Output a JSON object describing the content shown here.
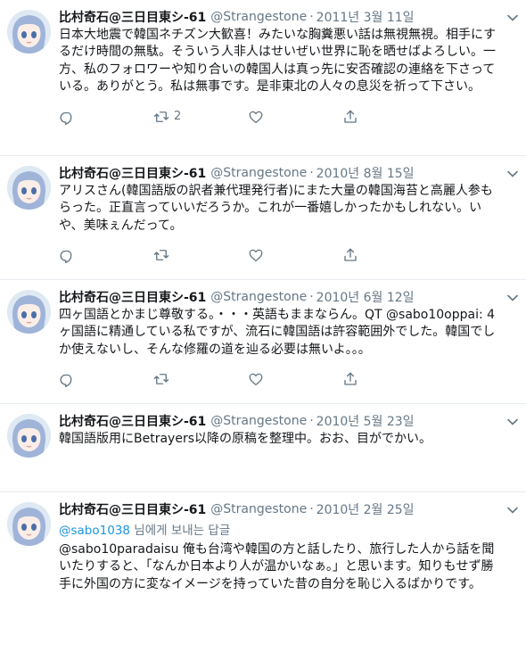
{
  "tweets": [
    {
      "name": "比村奇石@三日目東シ-61",
      "handle": "@Strangestone",
      "time": "2011년 3월 11일",
      "text": "日本大地震で韓国ネチズン大歓喜！みたいな胸糞悪い話は無視無視。相手にするだけ時間の無駄。そういう人非人はせいぜい世界に恥を晒せばよろしい。一方、私のフォロワーや知り合いの韓国人は真っ先に安否確認の連絡を下さっている。ありがとう。私は無事です。是非東北の人々の息災を祈って下さい。",
      "retweets": "2"
    },
    {
      "name": "比村奇石@三日目東シ-61",
      "handle": "@Strangestone",
      "time": "2010년 8월 15일",
      "text": "アリスさん(韓国語版の訳者兼代理発行者)にまた大量の韓国海苔と高麗人参もらった。正直言っていいだろうか。これが一番嬉しかったかもしれない。いや、美味ぇんだって。",
      "retweets": ""
    },
    {
      "name": "比村奇石@三日目東シ-61",
      "handle": "@Strangestone",
      "time": "2010년 6월 12일",
      "text": "四ヶ国語とかまじ尊敬する。・・・英語もままならん。QT @sabo10oppai: 4ヶ国語に精通している私ですが、流石に韓国語は許容範囲外でした。韓国でしか使えないし、そんな修羅の道を辿る必要は無いよ。。。",
      "retweets": ""
    },
    {
      "name": "比村奇石@三日目東シ-61",
      "handle": "@Strangestone",
      "time": "2010년 5월 23일",
      "text": "韓国語版用にBetrayers以降の原稿を整理中。おお、目がでかい。",
      "retweets": ""
    },
    {
      "name": "比村奇石@三日目東シ-61",
      "handle": "@Strangestone",
      "time": "2010년 2월 25일",
      "reply_to": "@sabo1038",
      "reply_suffix": " 님에게 보내는 답글",
      "text": "@sabo10paradaisu 俺も台湾や韓国の方と話したり、旅行した人から話を聞いたりすると、「なんか日本より人が温かいなぁ。」と思います。知りもせず勝手に外国の方に変なイメージを持っていた昔の自分を恥じ入るばかりです。",
      "retweets": ""
    }
  ],
  "icons": {
    "reply": "reply-icon",
    "retweet": "retweet-icon",
    "like": "like-icon",
    "share": "share-icon",
    "caret": "chevron-down-icon"
  },
  "colors": {
    "secondary_text": "#657786",
    "link": "#1b95e0",
    "divider": "#e6ecf0"
  }
}
